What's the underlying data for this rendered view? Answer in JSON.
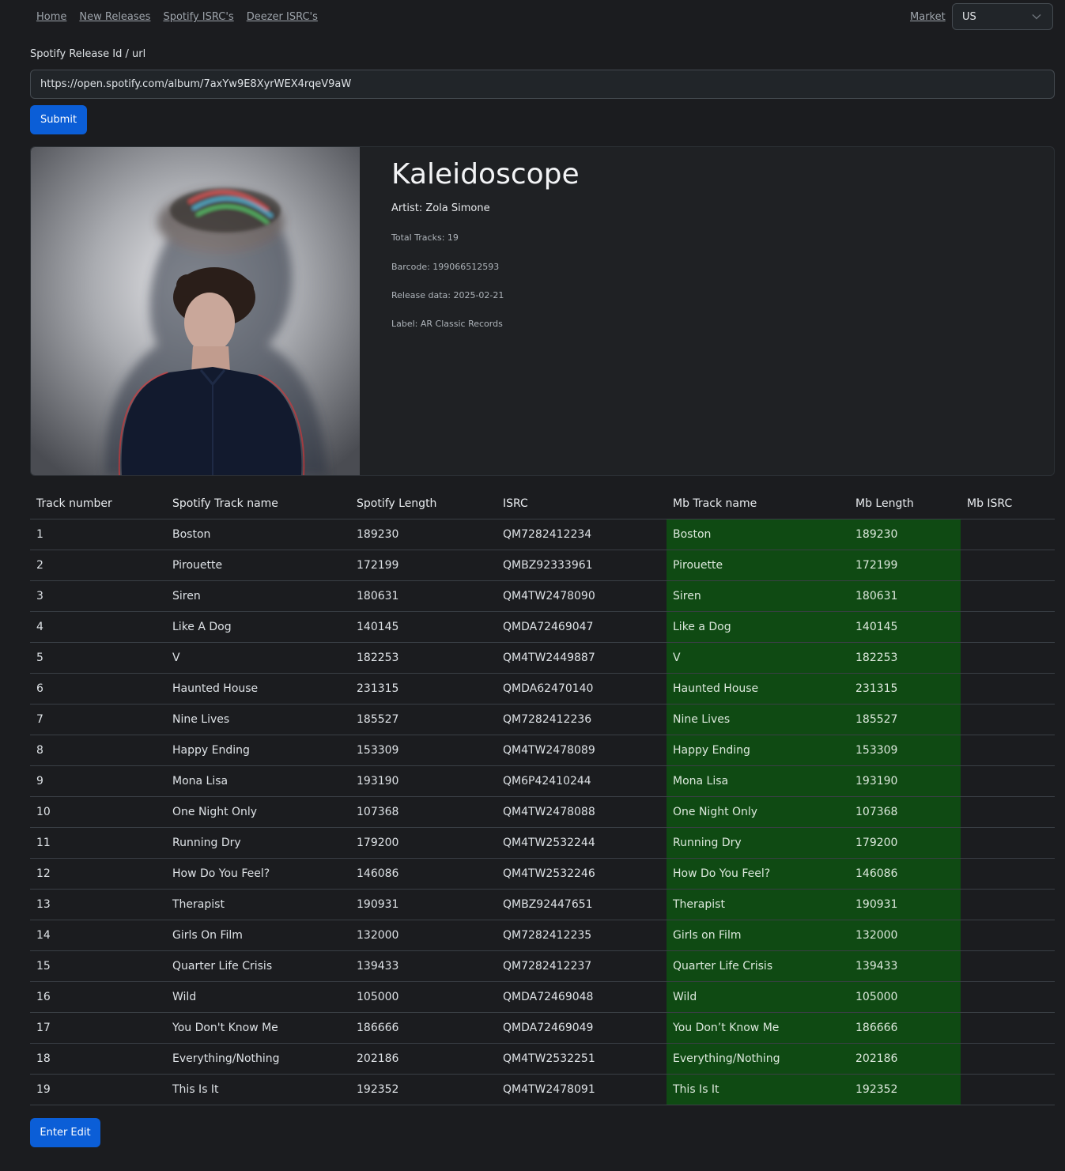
{
  "nav": {
    "links": [
      "Home",
      "New Releases",
      "Spotify ISRC's",
      "Deezer ISRC's"
    ],
    "market_label": "Market",
    "market_value": "US"
  },
  "form": {
    "label": "Spotify Release Id / url",
    "url_value": "https://open.spotify.com/album/7axYw9E8XyrWEX4rqeV9aW",
    "submit_label": "Submit"
  },
  "release": {
    "title": "Kaleidoscope",
    "artist": "Artist: Zola Simone",
    "total_tracks": "Total Tracks: 19",
    "barcode": "Barcode: 199066512593",
    "release_date": "Release data: 2025-02-21",
    "label": "Label: AR Classic Records"
  },
  "table": {
    "headers": [
      "Track number",
      "Spotify Track name",
      "Spotify Length",
      "ISRC",
      "Mb Track name",
      "Mb Length",
      "Mb ISRC"
    ],
    "rows": [
      [
        "1",
        "Boston",
        "189230",
        "QM7282412234",
        "Boston",
        "189230",
        ""
      ],
      [
        "2",
        "Pirouette",
        "172199",
        "QMBZ92333961",
        "Pirouette",
        "172199",
        ""
      ],
      [
        "3",
        "Siren",
        "180631",
        "QM4TW2478090",
        "Siren",
        "180631",
        ""
      ],
      [
        "4",
        "Like A Dog",
        "140145",
        "QMDA72469047",
        "Like a Dog",
        "140145",
        ""
      ],
      [
        "5",
        "V",
        "182253",
        "QM4TW2449887",
        "V",
        "182253",
        ""
      ],
      [
        "6",
        "Haunted House",
        "231315",
        "QMDA62470140",
        "Haunted House",
        "231315",
        ""
      ],
      [
        "7",
        "Nine Lives",
        "185527",
        "QM7282412236",
        "Nine Lives",
        "185527",
        ""
      ],
      [
        "8",
        "Happy Ending",
        "153309",
        "QM4TW2478089",
        "Happy Ending",
        "153309",
        ""
      ],
      [
        "9",
        "Mona Lisa",
        "193190",
        "QM6P42410244",
        "Mona Lisa",
        "193190",
        ""
      ],
      [
        "10",
        "One Night Only",
        "107368",
        "QM4TW2478088",
        "One Night Only",
        "107368",
        ""
      ],
      [
        "11",
        "Running Dry",
        "179200",
        "QM4TW2532244",
        "Running Dry",
        "179200",
        ""
      ],
      [
        "12",
        "How Do You Feel?",
        "146086",
        "QM4TW2532246",
        "How Do You Feel?",
        "146086",
        ""
      ],
      [
        "13",
        "Therapist",
        "190931",
        "QMBZ92447651",
        "Therapist",
        "190931",
        ""
      ],
      [
        "14",
        "Girls On Film",
        "132000",
        "QM7282412235",
        "Girls on Film",
        "132000",
        ""
      ],
      [
        "15",
        "Quarter Life Crisis",
        "139433",
        "QM7282412237",
        "Quarter Life Crisis",
        "139433",
        ""
      ],
      [
        "16",
        "Wild",
        "105000",
        "QMDA72469048",
        "Wild",
        "105000",
        ""
      ],
      [
        "17",
        "You Don't Know Me",
        "186666",
        "QMDA72469049",
        "You Don’t Know Me",
        "186666",
        ""
      ],
      [
        "18",
        "Everything/Nothing",
        "202186",
        "QM4TW2532251",
        "Everything/Nothing",
        "202186",
        ""
      ],
      [
        "19",
        "This Is It",
        "192352",
        "QM4TW2478091",
        "This Is It",
        "192352",
        ""
      ]
    ]
  },
  "actions": {
    "edit_label": "Enter Edit"
  },
  "colors": {
    "accent": "#0b5ed7",
    "match_green": "#0f4a13",
    "background": "#1b1c1f"
  }
}
